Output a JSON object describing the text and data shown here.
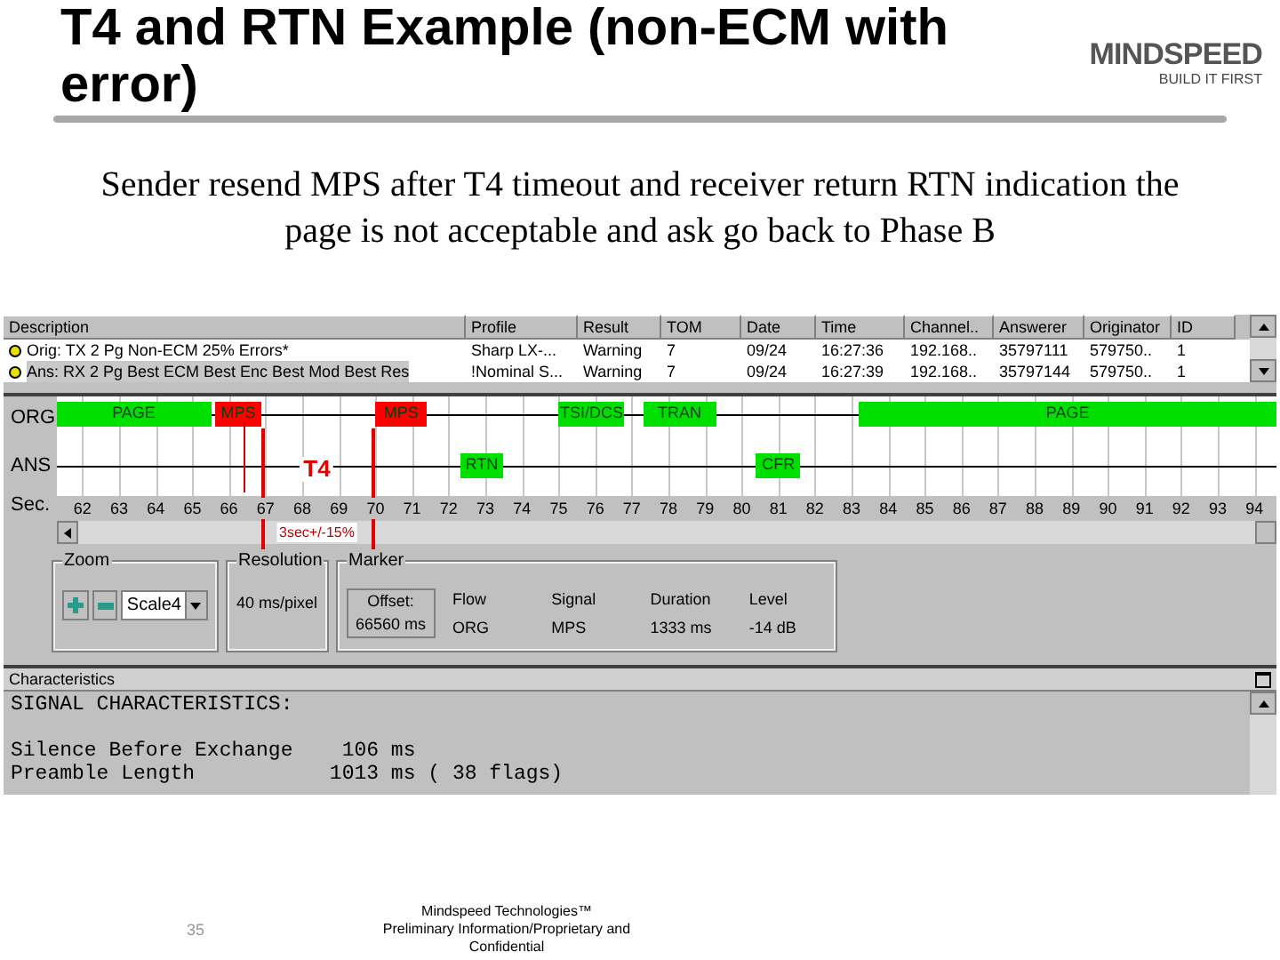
{
  "slide": {
    "title": "T4 and RTN Example (non-ECM with error)",
    "logo": {
      "wordmark": "MINDSPEED",
      "tagline": "BUILD IT FIRST"
    },
    "subtitle": "Sender resend MPS after T4 timeout and receiver return RTN indication the page is not acceptable and ask go back to Phase B",
    "page_number": "35",
    "footer": "Mindspeed Technologies™\nPreliminary Information/Proprietary and Confidential"
  },
  "table": {
    "columns": [
      "Description",
      "Profile",
      "Result",
      "TOM",
      "Date",
      "Time",
      "Channel..",
      "Answerer",
      "Originator",
      "ID"
    ],
    "rows": [
      {
        "selected": false,
        "cells": [
          "Orig: TX 2 Pg Non-ECM 25% Errors*",
          "Sharp LX-...",
          "Warning",
          "7",
          "09/24",
          "16:27:36",
          "192.168..",
          "35797111",
          "579750..",
          "1"
        ]
      },
      {
        "selected": true,
        "cells": [
          "Ans: RX 2 Pg Best ECM Best Enc Best Mod Best Res",
          "!Nominal S...",
          "Warning",
          "7",
          "09/24",
          "16:27:39",
          "192.168..",
          "35797144",
          "579750..",
          "1"
        ]
      }
    ]
  },
  "timeline": {
    "lanes": [
      {
        "label": "ORG",
        "signals": [
          {
            "label": "PAGE",
            "color": "#00e000"
          },
          {
            "label": "MPS",
            "color": "#ff0000"
          },
          {
            "label": "MPS",
            "color": "#ff0000"
          },
          {
            "label": "TSI/DCS",
            "color": "#00e000"
          },
          {
            "label": "TRAN",
            "color": "#00e000"
          },
          {
            "label": "PAGE",
            "color": "#00e000"
          }
        ]
      },
      {
        "label": "ANS",
        "signals": [
          {
            "label": "RTN",
            "color": "#00e000"
          },
          {
            "label": "CFR",
            "color": "#00e000"
          }
        ]
      }
    ],
    "axis_label": "Sec.",
    "ticks": [
      "62",
      "63",
      "64",
      "65",
      "66",
      "67",
      "68",
      "69",
      "70",
      "71",
      "72",
      "73",
      "74",
      "75",
      "76",
      "77",
      "78",
      "79",
      "80",
      "81",
      "82",
      "83",
      "84",
      "85",
      "86",
      "87",
      "88",
      "89",
      "90",
      "91",
      "92",
      "93",
      "94"
    ],
    "timer": {
      "label": "T4",
      "note": "3sec+/-15%"
    }
  },
  "controls": {
    "zoom": {
      "title": "Zoom",
      "scale": "Scale4"
    },
    "resolution": {
      "title": "Resolution",
      "value": "40 ms/pixel"
    },
    "marker": {
      "title": "Marker",
      "offset_label": "Offset:",
      "offset": "66560 ms",
      "columns": [
        "Flow",
        "Signal",
        "Duration",
        "Level"
      ],
      "values": [
        "ORG",
        "MPS",
        "1333 ms",
        "-14 dB"
      ]
    }
  },
  "characteristics": {
    "title": "Characteristics",
    "lines": [
      "SIGNAL CHARACTERISTICS:",
      "Silence Before Exchange    106 ms",
      "Preamble Length           1013 ms ( 38 flags)"
    ]
  }
}
